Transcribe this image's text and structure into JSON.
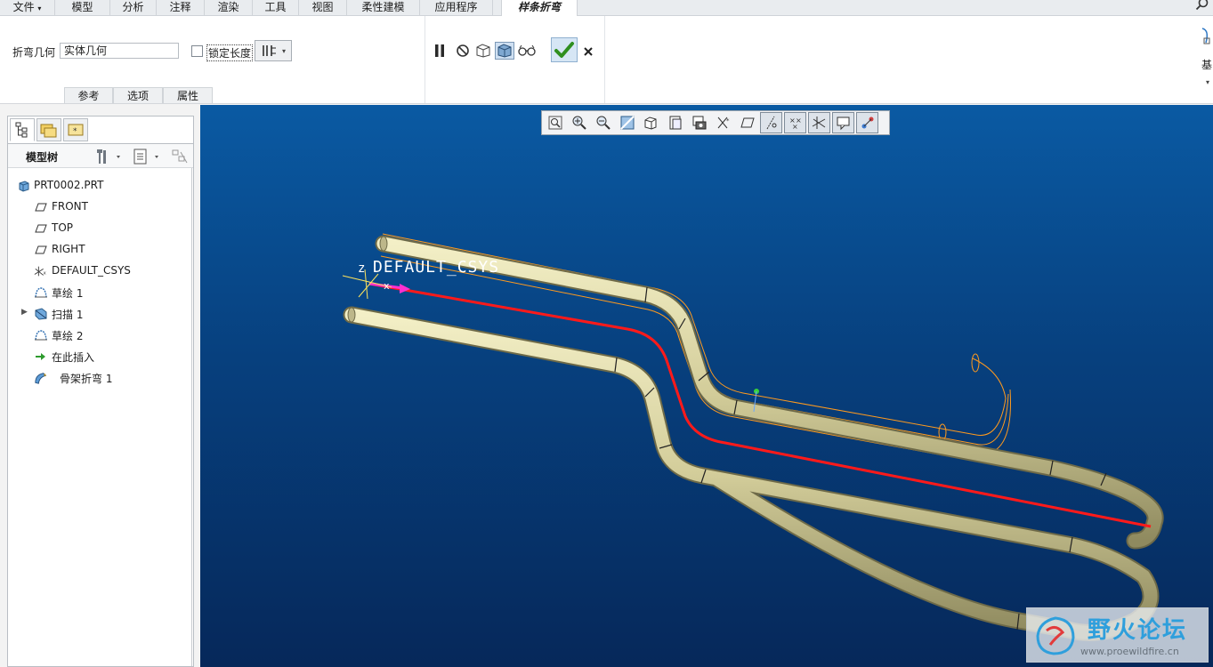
{
  "menu": {
    "items": [
      "文件",
      "模型",
      "分析",
      "注释",
      "渲染",
      "工具",
      "视图",
      "柔性建模",
      "应用程序"
    ],
    "active_tab": "样条折弯"
  },
  "ribbon": {
    "bend_geom_label": "折弯几何",
    "bend_geom_value": "实体几何",
    "lock_length_label": "锁定长度",
    "right_cut_label": "基",
    "subtabs": [
      "参考",
      "选项",
      "属性"
    ]
  },
  "left_panel": {
    "header_title": "模型树",
    "tree": [
      {
        "label": "PRT0002.PRT",
        "icon": "part-icon"
      },
      {
        "label": "FRONT",
        "icon": "datum-plane-icon"
      },
      {
        "label": "TOP",
        "icon": "datum-plane-icon"
      },
      {
        "label": "RIGHT",
        "icon": "datum-plane-icon"
      },
      {
        "label": "DEFAULT_CSYS",
        "icon": "csys-icon"
      },
      {
        "label": "草绘 1",
        "icon": "sketch-icon"
      },
      {
        "label": "扫描 1",
        "icon": "sweep-icon"
      },
      {
        "label": "草绘 2",
        "icon": "sketch-icon"
      },
      {
        "label": "在此插入",
        "icon": "insert-here-arrow-icon"
      },
      {
        "label": "骨架折弯 1",
        "icon": "spinal-bend-icon"
      }
    ]
  },
  "viewport": {
    "csys_label": "DEFAULT_CSYS",
    "axis_z": "z",
    "axis_x": "x",
    "watermark_title": "野火论坛",
    "watermark_url": "www.proewildfire.cn",
    "colors": {
      "tube": "#d8d3a6",
      "trajectory": "#ff1a1a",
      "preview": "#ff9a1e",
      "bg_top": "#0a5aa3",
      "bg_bottom": "#06285a"
    }
  }
}
